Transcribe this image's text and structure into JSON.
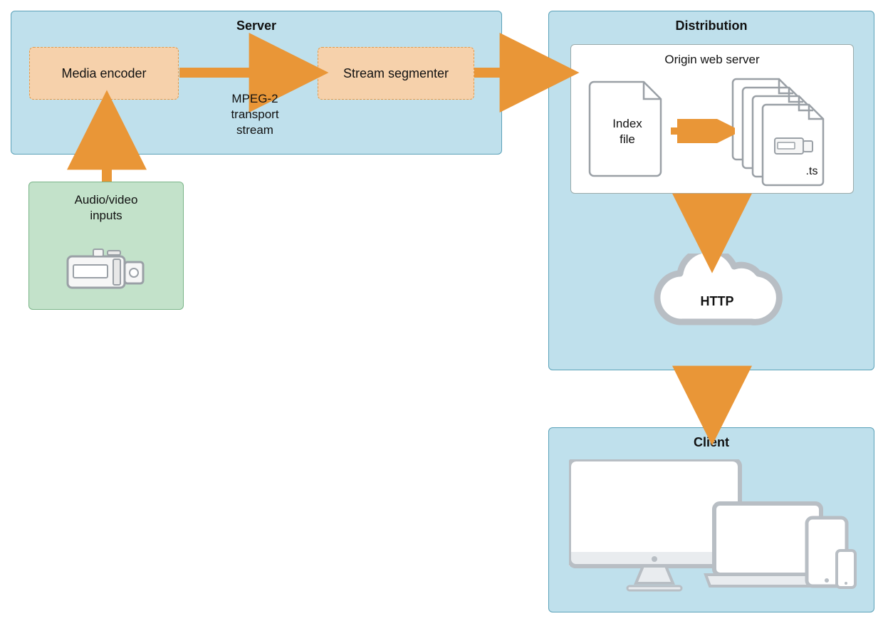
{
  "server": {
    "title": "Server",
    "media_encoder": "Media encoder",
    "stream_segmenter": "Stream segmenter",
    "arrow_label": "MPEG-2\ntransport\nstream"
  },
  "inputs": {
    "label": "Audio/video\ninputs"
  },
  "distribution": {
    "title": "Distribution",
    "origin_label": "Origin web server",
    "index_file": "Index\nfile",
    "ts_ext": ".ts",
    "http_label": "HTTP"
  },
  "client": {
    "title": "Client"
  }
}
